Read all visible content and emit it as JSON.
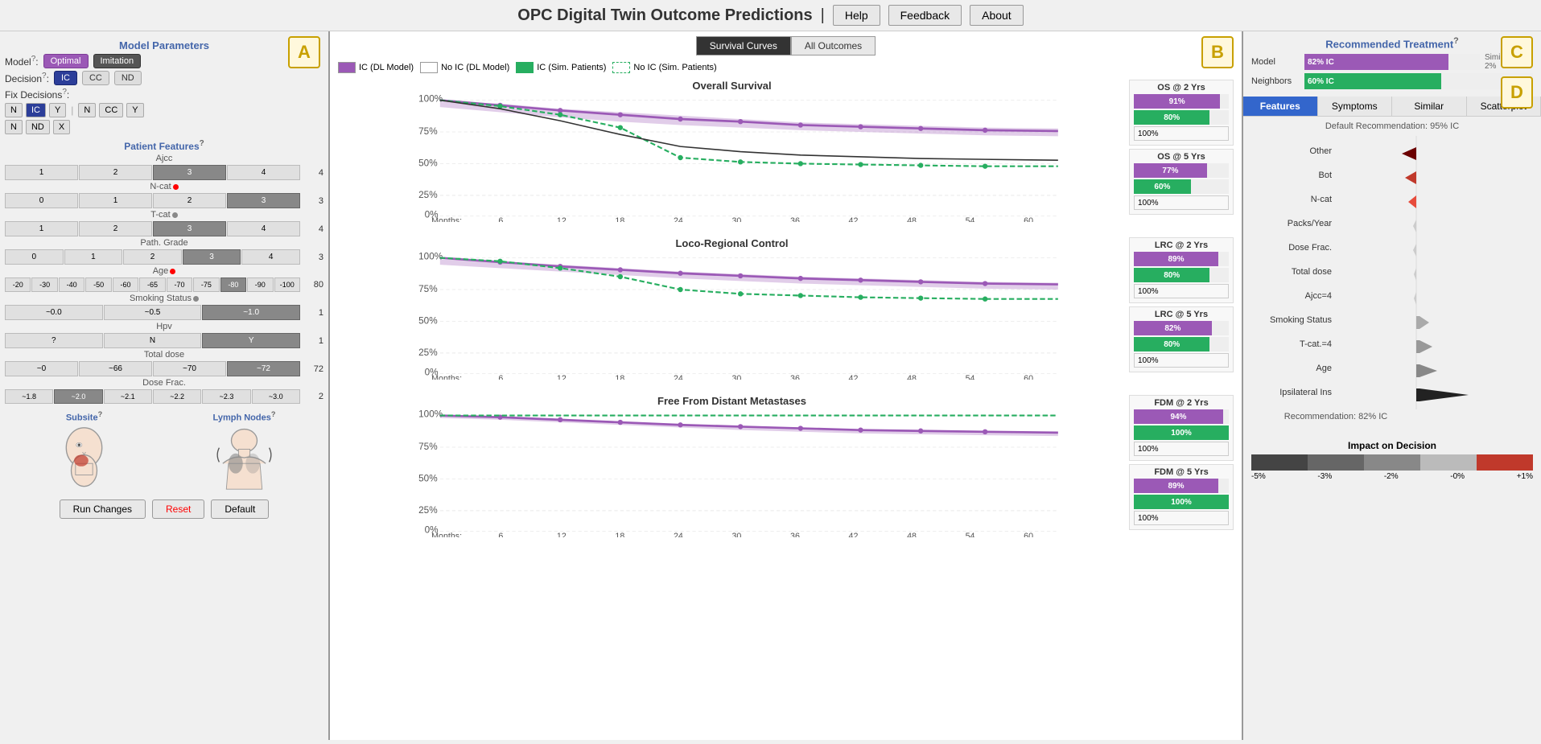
{
  "header": {
    "title": "OPC Digital Twin Outcome Predictions",
    "separator": "|",
    "help_btn": "Help",
    "feedback_btn": "Feedback",
    "about_btn": "About"
  },
  "panel_a": {
    "label": "A",
    "section_model": "Model Parameters",
    "model_label": "Model",
    "model_help": "?",
    "model_optimal": "Optimal",
    "model_imitation": "Imitation",
    "decision_label": "Decision",
    "decision_help": "?",
    "decision_ic": "IC",
    "decision_cc": "CC",
    "decision_nd": "ND",
    "fix_label": "Fix Decisions",
    "fix_help": "?",
    "fix_n1": "N",
    "fix_ic": "IC",
    "fix_y1": "Y",
    "fix_n2": "N",
    "fix_cc": "CC",
    "fix_y2": "Y",
    "fix_n3": "N",
    "fix_nd": "ND",
    "fix_x": "X",
    "patient_features": "Patient Features",
    "patient_help": "?",
    "ajcc_label": "Ajcc",
    "ajcc_options": [
      "1",
      "2",
      "3",
      "4"
    ],
    "ajcc_active": 2,
    "ajcc_value": "4",
    "ncat_label": "N-cat",
    "ncat_options": [
      "0",
      "1",
      "2",
      "3"
    ],
    "ncat_active": 3,
    "ncat_value": "3",
    "tcat_label": "T-cat",
    "tcat_options": [
      "1",
      "2",
      "3",
      "4"
    ],
    "tcat_active": 2,
    "tcat_value": "4",
    "pathgrade_label": "Path. Grade",
    "pathgrade_options": [
      "0",
      "1",
      "2",
      "3",
      "4"
    ],
    "pathgrade_active": 3,
    "pathgrade_value": "3",
    "age_label": "Age",
    "age_options": [
      "-20",
      "-30",
      "-40",
      "-50",
      "-60",
      "-65",
      "-70",
      "-75",
      "-80",
      "-90",
      "-100"
    ],
    "age_active": 8,
    "age_value": "80",
    "smoking_label": "Smoking Status",
    "smoking_options": [
      "~0.0",
      "~0.5",
      "~1.0"
    ],
    "smoking_active": 2,
    "smoking_value": "1",
    "hpv_label": "Hpv",
    "hpv_options": [
      "?",
      "N",
      "Y"
    ],
    "hpv_active": 2,
    "hpv_value": "1",
    "totaldose_label": "Total dose",
    "totaldose_options": [
      "~0",
      "~66",
      "~70",
      "~72"
    ],
    "totaldose_active": 3,
    "totaldose_value": "72",
    "dosefrac_label": "Dose Frac.",
    "dosefrac_options": [
      "~1.8",
      "~2.0",
      "~2.1",
      "~2.2",
      "~2.3",
      "~3.0"
    ],
    "dosefrac_active": 1,
    "dosefrac_value": "2",
    "subsite_label": "Subsite",
    "subsite_help": "?",
    "lymphnodes_label": "Lymph Nodes",
    "lymphnodes_help": "?",
    "run_btn": "Run Changes",
    "reset_btn": "Reset",
    "default_btn": "Default"
  },
  "panel_b": {
    "label": "B",
    "tab_survival": "Survival Curves",
    "tab_outcomes": "All Outcomes",
    "legend": [
      {
        "color": "purple",
        "label": "IC (DL Model)"
      },
      {
        "color": "white",
        "label": "No IC (DL Model)"
      },
      {
        "color": "green_fill",
        "label": "IC (Sim. Patients)"
      },
      {
        "color": "green_outline",
        "label": "No IC (Sim. Patients)"
      }
    ],
    "charts": [
      {
        "title": "Overall Survival",
        "x_label": "Months:",
        "x_ticks": [
          "6",
          "12",
          "18",
          "24",
          "30",
          "36",
          "42",
          "48",
          "54",
          "60"
        ],
        "outcomes": [
          {
            "title": "OS @ 2 Yrs",
            "bars": [
              {
                "pct": 91,
                "label": "91%",
                "color": "purple"
              },
              {
                "pct": 80,
                "label": "80%",
                "color": "green"
              },
              {
                "pct": 100,
                "label": "100%",
                "color": "white_outline"
              }
            ]
          },
          {
            "title": "OS @ 5 Yrs",
            "bars": [
              {
                "pct": 77,
                "label": "77%",
                "color": "purple"
              },
              {
                "pct": 60,
                "label": "60%",
                "color": "green"
              },
              {
                "pct": 100,
                "label": "100%",
                "color": "white_outline"
              }
            ]
          }
        ]
      },
      {
        "title": "Loco-Regional Control",
        "x_label": "Months:",
        "x_ticks": [
          "6",
          "12",
          "18",
          "24",
          "30",
          "36",
          "42",
          "48",
          "54",
          "60"
        ],
        "outcomes": [
          {
            "title": "LRC @ 2 Yrs",
            "bars": [
              {
                "pct": 89,
                "label": "89%",
                "color": "purple"
              },
              {
                "pct": 80,
                "label": "80%",
                "color": "green"
              },
              {
                "pct": 100,
                "label": "100%",
                "color": "white_outline"
              }
            ]
          },
          {
            "title": "LRC @ 5 Yrs",
            "bars": [
              {
                "pct": 82,
                "label": "82%",
                "color": "purple"
              },
              {
                "pct": 80,
                "label": "80%",
                "color": "green"
              },
              {
                "pct": 100,
                "label": "100%",
                "color": "white_outline"
              }
            ]
          }
        ]
      },
      {
        "title": "Free From Distant Metastases",
        "x_label": "Months:",
        "x_ticks": [
          "6",
          "12",
          "18",
          "24",
          "30",
          "36",
          "42",
          "48",
          "54",
          "60"
        ],
        "outcomes": [
          {
            "title": "FDM @ 2 Yrs",
            "bars": [
              {
                "pct": 94,
                "label": "94%",
                "color": "purple"
              },
              {
                "pct": 100,
                "label": "100%",
                "color": "green"
              },
              {
                "pct": 100,
                "label": "100%",
                "color": "white_outline"
              }
            ]
          },
          {
            "title": "FDM @ 5 Yrs",
            "bars": [
              {
                "pct": 89,
                "label": "89%",
                "color": "purple"
              },
              {
                "pct": 100,
                "label": "100%",
                "color": "green"
              },
              {
                "pct": 100,
                "label": "100%",
                "color": "white_outline"
              }
            ]
          }
        ]
      }
    ]
  },
  "panel_c": {
    "label": "C",
    "rec_title": "Recommended Treatment",
    "rec_help": "?",
    "model_label": "Model",
    "model_pct": "82% IC",
    "model_bar_width": 82,
    "model_side": "Similar t... 2%",
    "neighbors_label": "Neighbors",
    "neighbors_pct": "60% IC",
    "neighbors_bar_width": 60,
    "tabs": [
      "Features",
      "Symptoms",
      "Similar",
      "Scatterplot"
    ],
    "active_tab": 0,
    "label_d": "D",
    "default_rec": "Default Recommendation: 95% IC",
    "features": [
      {
        "name": "Other",
        "arrow_size": 18,
        "direction": "left",
        "color": "#8b0000"
      },
      {
        "name": "Bot",
        "arrow_size": 16,
        "direction": "left",
        "color": "#c0392b"
      },
      {
        "name": "N-cat",
        "arrow_size": 14,
        "direction": "left",
        "color": "#e74c3c"
      },
      {
        "name": "Packs/Year",
        "arrow_size": 8,
        "direction": "none",
        "color": "#ccc"
      },
      {
        "name": "Dose Frac.",
        "arrow_size": 8,
        "direction": "none",
        "color": "#ccc"
      },
      {
        "name": "Total dose",
        "arrow_size": 6,
        "direction": "none",
        "color": "#ccc"
      },
      {
        "name": "Ajcc=4",
        "arrow_size": 6,
        "direction": "none",
        "color": "#ccc"
      },
      {
        "name": "Smoking Status",
        "arrow_size": 10,
        "direction": "right",
        "color": "#aaa"
      },
      {
        "name": "T-cat.=4",
        "arrow_size": 12,
        "direction": "right",
        "color": "#999"
      },
      {
        "name": "Age",
        "arrow_size": 14,
        "direction": "right",
        "color": "#888"
      },
      {
        "name": "Ipsilateral Ins",
        "arrow_size": 30,
        "direction": "right",
        "color": "#222"
      }
    ],
    "bottom_rec": "Recommendation: 82% IC",
    "impact_title": "Impact on Decision",
    "impact_labels": [
      "-5%",
      "-3%",
      "-2%",
      "-0%",
      "+1%"
    ],
    "impact_colors": [
      "#555",
      "#777",
      "#999",
      "#bbb",
      "#c0392b"
    ]
  }
}
